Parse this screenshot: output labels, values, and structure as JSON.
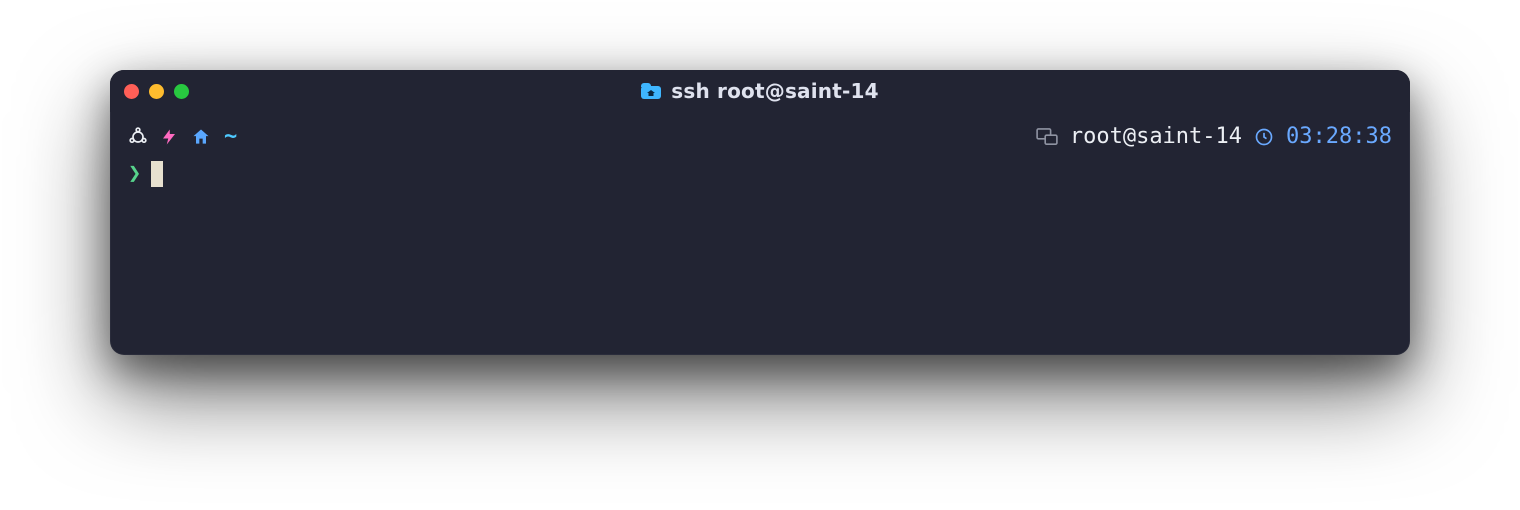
{
  "window": {
    "title": "ssh root@saint-14"
  },
  "prompt": {
    "left": {
      "tilde": "~"
    },
    "right": {
      "host": "root@saint-14",
      "time": "03:28:38"
    },
    "symbol": "❯"
  },
  "icons": {
    "os": "ubuntu-icon",
    "power": "lightning-icon",
    "home": "home-icon",
    "remote": "remote-icon",
    "clock": "clock-icon",
    "folder": "folder-icon"
  },
  "colors": {
    "pink": "#ff6ac1",
    "blue": "#5aa7ff",
    "cyan": "#4ec9ff",
    "prompt_green": "#57d38c",
    "time": "#6aa9ff",
    "muted": "#8f93a2",
    "folder": "#3fb6ff",
    "cursor": "#e7e0cf",
    "bg": "#222433"
  }
}
